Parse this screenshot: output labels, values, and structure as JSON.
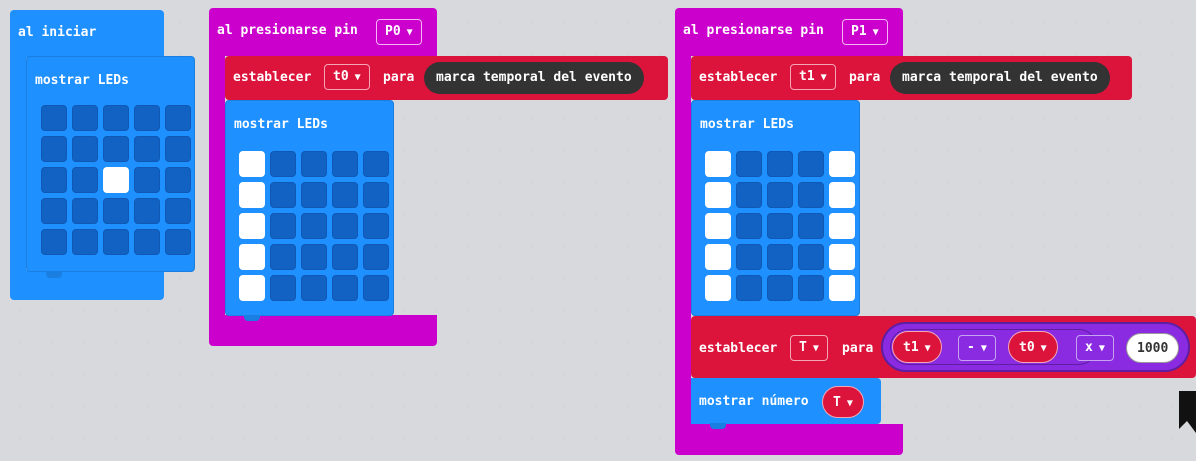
{
  "blocks": {
    "on_start": {
      "label": "al iniciar",
      "show_leds_label": "mostrar LEDs",
      "leds": [
        [
          0,
          0,
          0,
          0,
          0
        ],
        [
          0,
          0,
          0,
          0,
          0
        ],
        [
          0,
          0,
          1,
          0,
          0
        ],
        [
          0,
          0,
          0,
          0,
          0
        ],
        [
          0,
          0,
          0,
          0,
          0
        ]
      ]
    },
    "on_pin_p0": {
      "label": "al presionarse pin",
      "pin": "P0",
      "set_label": "establecer",
      "variable": "t0",
      "to_label": "para",
      "value": "marca temporal del evento",
      "show_leds_label": "mostrar LEDs",
      "leds": [
        [
          1,
          0,
          0,
          0,
          0
        ],
        [
          1,
          0,
          0,
          0,
          0
        ],
        [
          1,
          0,
          0,
          0,
          0
        ],
        [
          1,
          0,
          0,
          0,
          0
        ],
        [
          1,
          0,
          0,
          0,
          0
        ]
      ]
    },
    "on_pin_p1": {
      "label": "al presionarse pin",
      "pin": "P1",
      "set_label": "establecer",
      "variable": "t1",
      "to_label": "para",
      "value": "marca temporal del evento",
      "show_leds_label": "mostrar LEDs",
      "leds": [
        [
          1,
          0,
          0,
          0,
          1
        ],
        [
          1,
          0,
          0,
          0,
          1
        ],
        [
          1,
          0,
          0,
          0,
          1
        ],
        [
          1,
          0,
          0,
          0,
          1
        ],
        [
          1,
          0,
          0,
          0,
          1
        ]
      ],
      "set2_label": "establecer",
      "set2_variable": "T",
      "set2_to_label": "para",
      "expr_left": "t1",
      "expr_minus_op": "-",
      "expr_right": "t0",
      "expr_times_op": "x",
      "expr_factor": "1000",
      "show_number_label": "mostrar número",
      "show_number_var": "T"
    }
  },
  "colors": {
    "basic_blue": "#1e90ff",
    "input_magenta": "#cc00cc",
    "variables_red": "#dc143c",
    "math_purple": "#8a2be2",
    "reporter_dark": "#333333",
    "workspace": "#ecedef"
  },
  "icons": {
    "dropdown": "triangle-down",
    "corner": "bookmark-icon"
  }
}
